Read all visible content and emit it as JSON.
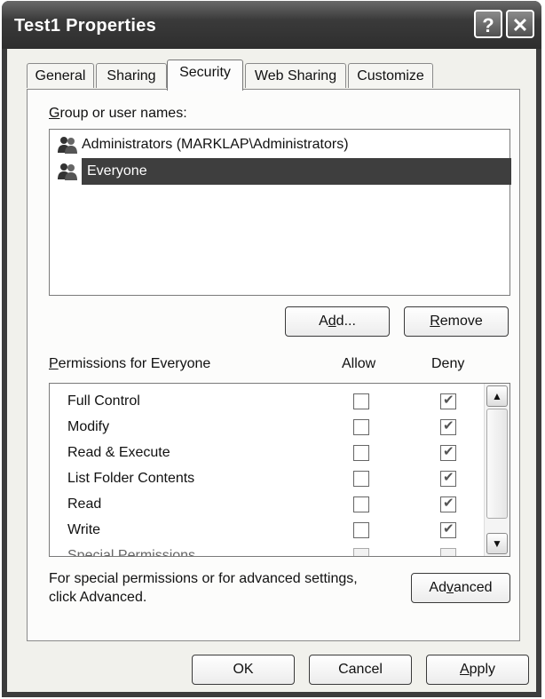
{
  "window": {
    "title": "Test1 Properties",
    "help_glyph": "?",
    "close_glyph": "✕"
  },
  "tabs": [
    {
      "label": "General"
    },
    {
      "label": "Sharing"
    },
    {
      "label": "Security"
    },
    {
      "label": "Web Sharing"
    },
    {
      "label": "Customize"
    }
  ],
  "active_tab": "Security",
  "group_label_first": "G",
  "group_label_rest": "roup or user names:",
  "users": [
    {
      "name": "Administrators (MARKLAP\\Administrators)",
      "selected": false,
      "icon": "users-group-icon"
    },
    {
      "name": "Everyone",
      "selected": true,
      "icon": "users-group-icon"
    }
  ],
  "buttons": {
    "add_a": "A",
    "add_u": "d",
    "add_rest": "d...",
    "remove_u": "R",
    "remove_rest": "emove",
    "advanced_a": "Ad",
    "advanced_u": "v",
    "advanced_rest": "anced",
    "ok": "OK",
    "cancel": "Cancel",
    "apply_u": "A",
    "apply_rest": "pply"
  },
  "permissions": {
    "label_u": "P",
    "label_rest": "ermissions for Everyone",
    "allow_header": "Allow",
    "deny_header": "Deny",
    "rows": [
      {
        "name": "Full Control",
        "allow": false,
        "deny": true
      },
      {
        "name": "Modify",
        "allow": false,
        "deny": true
      },
      {
        "name": "Read & Execute",
        "allow": false,
        "deny": true
      },
      {
        "name": "List Folder Contents",
        "allow": false,
        "deny": true
      },
      {
        "name": "Read",
        "allow": false,
        "deny": true
      },
      {
        "name": "Write",
        "allow": false,
        "deny": true
      },
      {
        "name": "Special Permissions",
        "allow": false,
        "deny": false
      }
    ]
  },
  "advanced_note": "For special permissions or for advanced settings, click Advanced.",
  "scroll_up_glyph": "▲",
  "scroll_down_glyph": "▼"
}
